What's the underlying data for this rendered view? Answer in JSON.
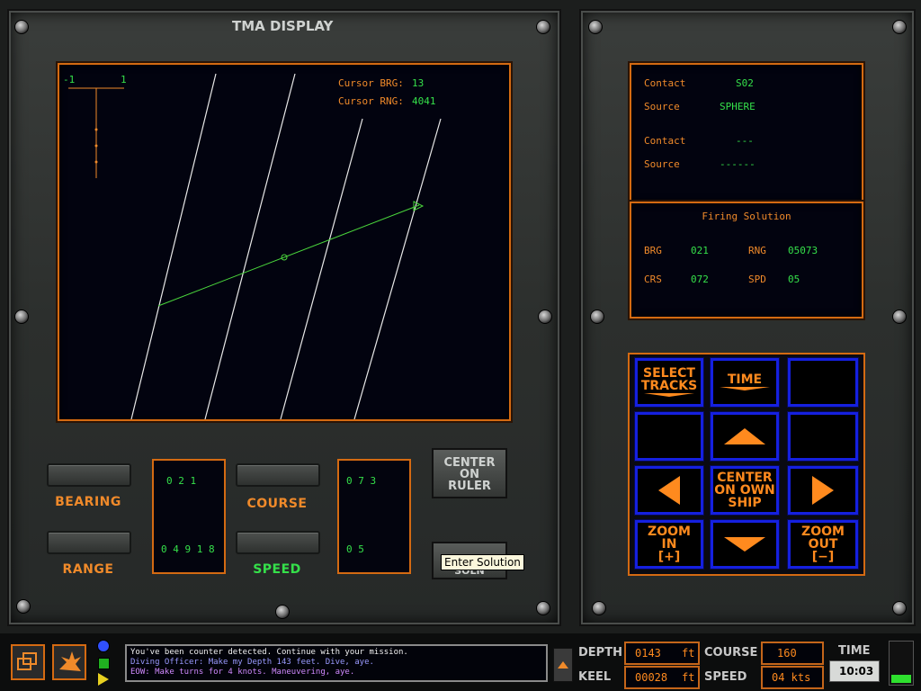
{
  "tma": {
    "title": "TMA DISPLAY",
    "ruler_left": "-1",
    "ruler_right": "1",
    "cursor_brg_label": "Cursor BRG:",
    "cursor_brg_value": "13",
    "cursor_rng_label": "Cursor RNG:",
    "cursor_rng_value": "4041"
  },
  "controls": {
    "bearing_label": "BEARING",
    "range_label": "RANGE",
    "course_label": "COURSE",
    "speed_label": "SPEED",
    "bearing_value": "0 2 1",
    "range_value": "0 4 9 1 8",
    "course_value": "0 7 3",
    "speed_value": "0 5",
    "center_on_ruler": [
      "CENTER",
      "ON",
      "RULER"
    ],
    "enter_solution_partial": "SOLN",
    "tooltip": "Enter Solution"
  },
  "contacts": {
    "contact1_label": "Contact",
    "contact1_value": "S02",
    "source1_label": "Source",
    "source1_value": "SPHERE",
    "contact2_label": "Contact",
    "contact2_value": "---",
    "source2_label": "Source",
    "source2_value": "------"
  },
  "firing": {
    "title": "Firing Solution",
    "brg_label": "BRG",
    "brg_value": "021",
    "rng_label": "RNG",
    "rng_value": "05073",
    "crs_label": "CRS",
    "crs_value": "072",
    "spd_label": "SPD",
    "spd_value": "05"
  },
  "keypad": {
    "select_tracks": [
      "SELECT",
      "TRACKS"
    ],
    "time": "TIME",
    "center_own_ship": [
      "CENTER",
      "ON OWN",
      "SHIP"
    ],
    "zoom_in": [
      "ZOOM",
      "IN",
      "[+]"
    ],
    "zoom_out": [
      "ZOOM",
      "OUT",
      "[−]"
    ]
  },
  "status": {
    "messages": [
      "You've been counter detected.  Continue with your mission.",
      "Diving Officer: Make my Depth 143 feet. Dive, aye.",
      "EOW: Make turns for 4 knots.  Maneuvering, aye."
    ],
    "depth_label": "DEPTH",
    "depth_value": "0143",
    "depth_unit": "ft",
    "keel_label": "KEEL",
    "keel_value": "00028",
    "keel_unit": "ft",
    "course_label": "COURSE",
    "course_value": "160",
    "speed_label": "SPEED",
    "speed_value": "04 kts",
    "time_label": "TIME",
    "time_value": "10:03",
    "gauge_level": 0.2
  },
  "colors": {
    "accent_orange": "#f08a2a",
    "readout_green": "#35e04a",
    "keypad_blue": "#1520e0"
  }
}
